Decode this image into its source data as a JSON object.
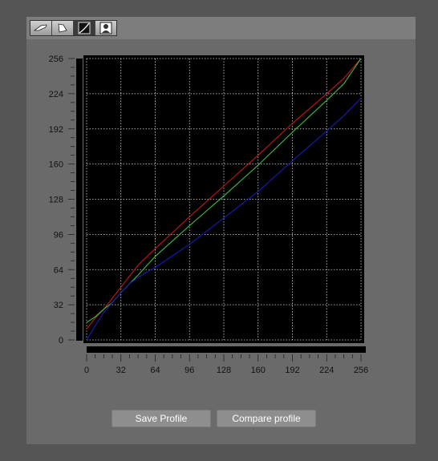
{
  "toolbar": {
    "buttons": [
      {
        "icon": "brush-icon"
      },
      {
        "icon": "spray-icon"
      },
      {
        "icon": "curve-icon",
        "active": true
      },
      {
        "icon": "portrait-icon"
      }
    ]
  },
  "buttons": {
    "save_label": "Save Profile",
    "compare_label": "Compare profile"
  },
  "chart_data": {
    "type": "line",
    "xlim": [
      0,
      256
    ],
    "ylim": [
      0,
      256
    ],
    "xticks": [
      0,
      32,
      64,
      96,
      128,
      160,
      192,
      224,
      256
    ],
    "yticks": [
      0,
      32,
      64,
      96,
      128,
      160,
      192,
      224,
      256
    ],
    "grid": true,
    "background": "#000000",
    "series": [
      {
        "color": "#c01818",
        "x": [
          0,
          8,
          16,
          24,
          32,
          40,
          48,
          64,
          96,
          128,
          160,
          192,
          224,
          240,
          256
        ],
        "y": [
          10,
          20,
          28,
          38,
          48,
          58,
          68,
          83,
          112,
          140,
          168,
          197,
          224,
          238,
          256
        ]
      },
      {
        "color": "#3fbf3f",
        "x": [
          0,
          8,
          16,
          24,
          32,
          40,
          48,
          64,
          96,
          128,
          160,
          192,
          224,
          240,
          256
        ],
        "y": [
          16,
          21,
          28,
          34,
          43,
          51,
          59,
          76,
          104,
          131,
          159,
          189,
          218,
          233,
          256
        ]
      },
      {
        "color": "#1a1ab8",
        "x": [
          0,
          8,
          16,
          24,
          32,
          40,
          48,
          64,
          96,
          128,
          160,
          192,
          224,
          240,
          256
        ],
        "y": [
          0,
          13,
          25,
          34,
          43,
          51,
          57,
          66,
          87,
          111,
          135,
          163,
          190,
          204,
          220
        ]
      }
    ]
  }
}
